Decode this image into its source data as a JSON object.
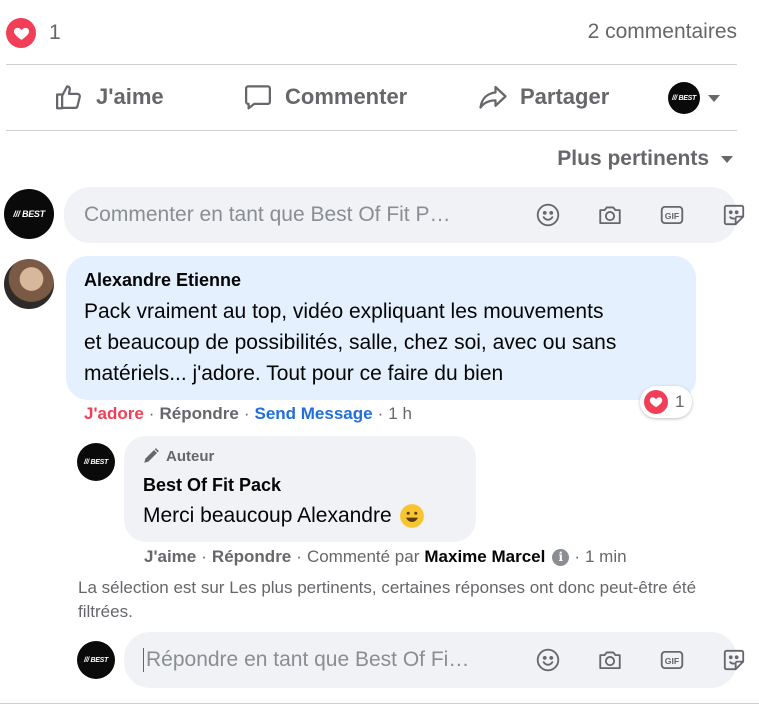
{
  "stats": {
    "reaction_count": "1",
    "comments_count": "2 commentaires"
  },
  "actions": {
    "like": "J'aime",
    "comment": "Commenter",
    "share": "Partager"
  },
  "sort_label": "Plus pertinents",
  "composer": {
    "placeholder": "Commenter en tant que Best Of Fit P…"
  },
  "avatar_logo": "/// BEST",
  "comment": {
    "author": "Alexandre Etienne",
    "lines": [
      "Pack vraiment au top, vidéo expliquant les mouvements",
      "et beaucoup de possibilités, salle, chez soi, avec ou sans",
      "matériels... j'adore. Tout pour ce faire du bien"
    ],
    "reaction_label": "J'adore",
    "reply_label": "Répondre",
    "send_message_label": "Send Message",
    "time": "1 h",
    "reaction_count": "1"
  },
  "reply": {
    "badge": "Auteur",
    "author": "Best Of Fit Pack",
    "text": "Merci beaucoup Alexandre",
    "like_label": "J'aime",
    "reply_label": "Répondre",
    "commented_by_prefix": "Commenté par",
    "commented_by_name": "Maxime Marcel",
    "time": "1 min"
  },
  "filter_note": "La sélection est sur Les plus pertinents, certaines réponses ont donc peut-être été filtrées.",
  "reply_composer": {
    "placeholder": "Répondre en tant que Best Of Fi…"
  },
  "colors": {
    "love": "#f33e58",
    "link_blue": "#216fdb",
    "bubble_blue": "#e4f0fd",
    "muted": "#65676b"
  },
  "icons": [
    "heart-icon",
    "thumbs-up-icon",
    "comment-icon",
    "share-icon",
    "emoji-icon",
    "camera-icon",
    "gif-icon",
    "sticker-icon",
    "pencil-icon",
    "info-icon",
    "smiley-emoji"
  ]
}
